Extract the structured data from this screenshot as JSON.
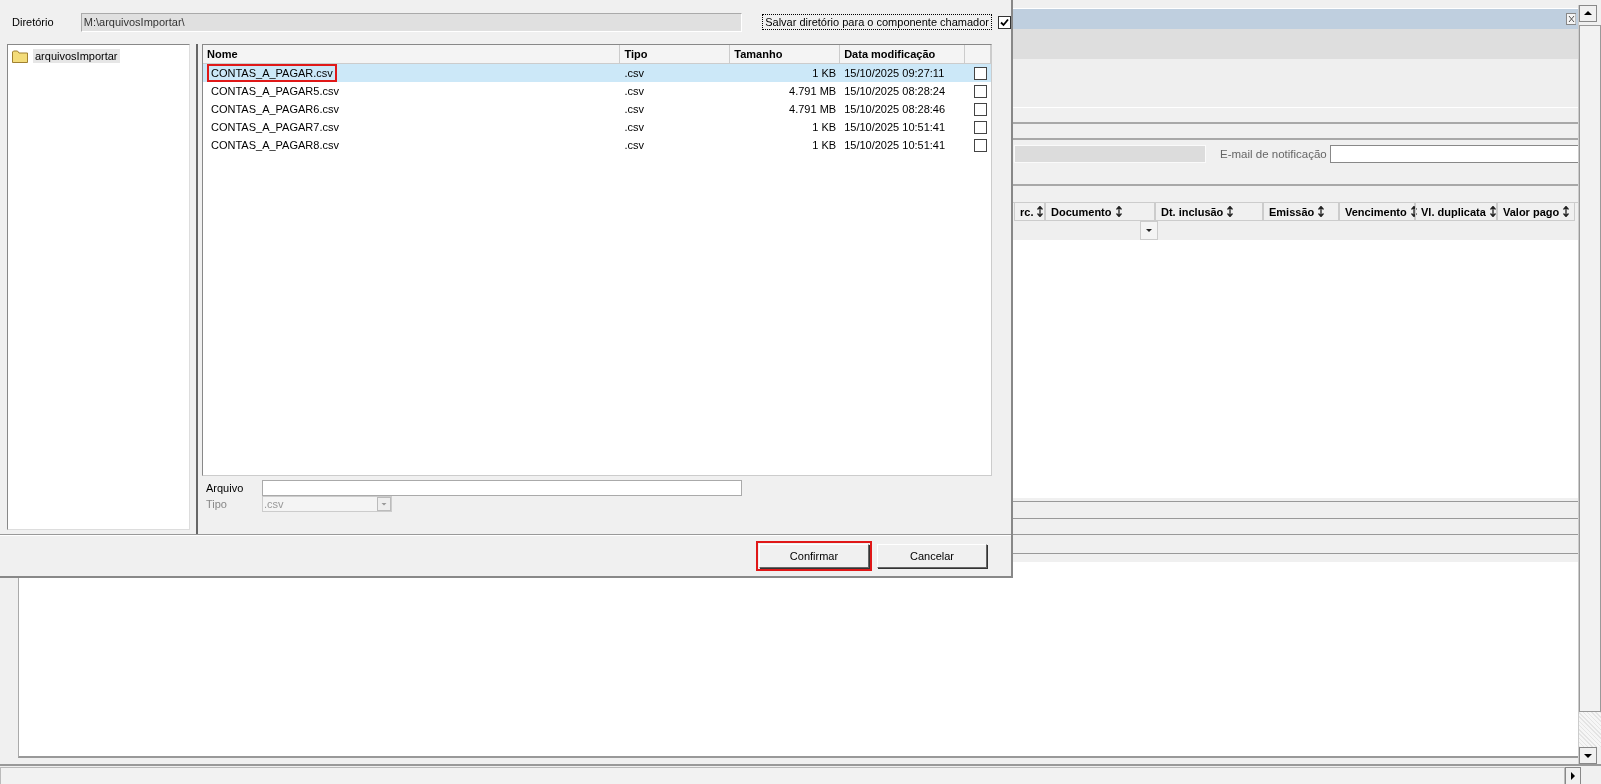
{
  "dialog": {
    "directory_label": "Diretório",
    "directory_value": "M:\\arquivosImportar\\",
    "save_directory": {
      "label": "Salvar diretório para o componente chamador",
      "checked": true
    },
    "folders": [
      {
        "name": "arquivosImportar",
        "selected": true
      }
    ],
    "file_columns": [
      "Nome",
      "Tipo",
      "Tamanho",
      "Data modificação"
    ],
    "files": [
      {
        "name": "CONTAS_A_PAGAR.csv",
        "type": ".csv",
        "size": "1 KB",
        "modified": "15/10/2025 09:27:11",
        "selected": true,
        "checked": false,
        "highlighted": true
      },
      {
        "name": "CONTAS_A_PAGAR5.csv",
        "type": ".csv",
        "size": "4.791 MB",
        "modified": "15/10/2025 08:28:24",
        "selected": false,
        "checked": false,
        "highlighted": false
      },
      {
        "name": "CONTAS_A_PAGAR6.csv",
        "type": ".csv",
        "size": "4.791 MB",
        "modified": "15/10/2025 08:28:46",
        "selected": false,
        "checked": false,
        "highlighted": false
      },
      {
        "name": "CONTAS_A_PAGAR7.csv",
        "type": ".csv",
        "size": "1 KB",
        "modified": "15/10/2025 10:51:41",
        "selected": false,
        "checked": false,
        "highlighted": false
      },
      {
        "name": "CONTAS_A_PAGAR8.csv",
        "type": ".csv",
        "size": "1 KB",
        "modified": "15/10/2025 10:51:41",
        "selected": false,
        "checked": false,
        "highlighted": false
      }
    ],
    "file_field": {
      "label": "Arquivo"
    },
    "type_field": {
      "label": "Tipo",
      "value": ".csv",
      "disabled": true
    },
    "buttons": [
      {
        "label": "Confirmar",
        "highlighted": true
      },
      {
        "label": "Cancelar",
        "highlighted": false
      }
    ]
  },
  "background": {
    "email_label": "E-mail de notificação",
    "grid_columns": [
      "rc.",
      "Documento",
      "Dt. inclusão",
      "Emissão",
      "Vencimento",
      "Vl. duplicata",
      "Valor pago"
    ]
  }
}
